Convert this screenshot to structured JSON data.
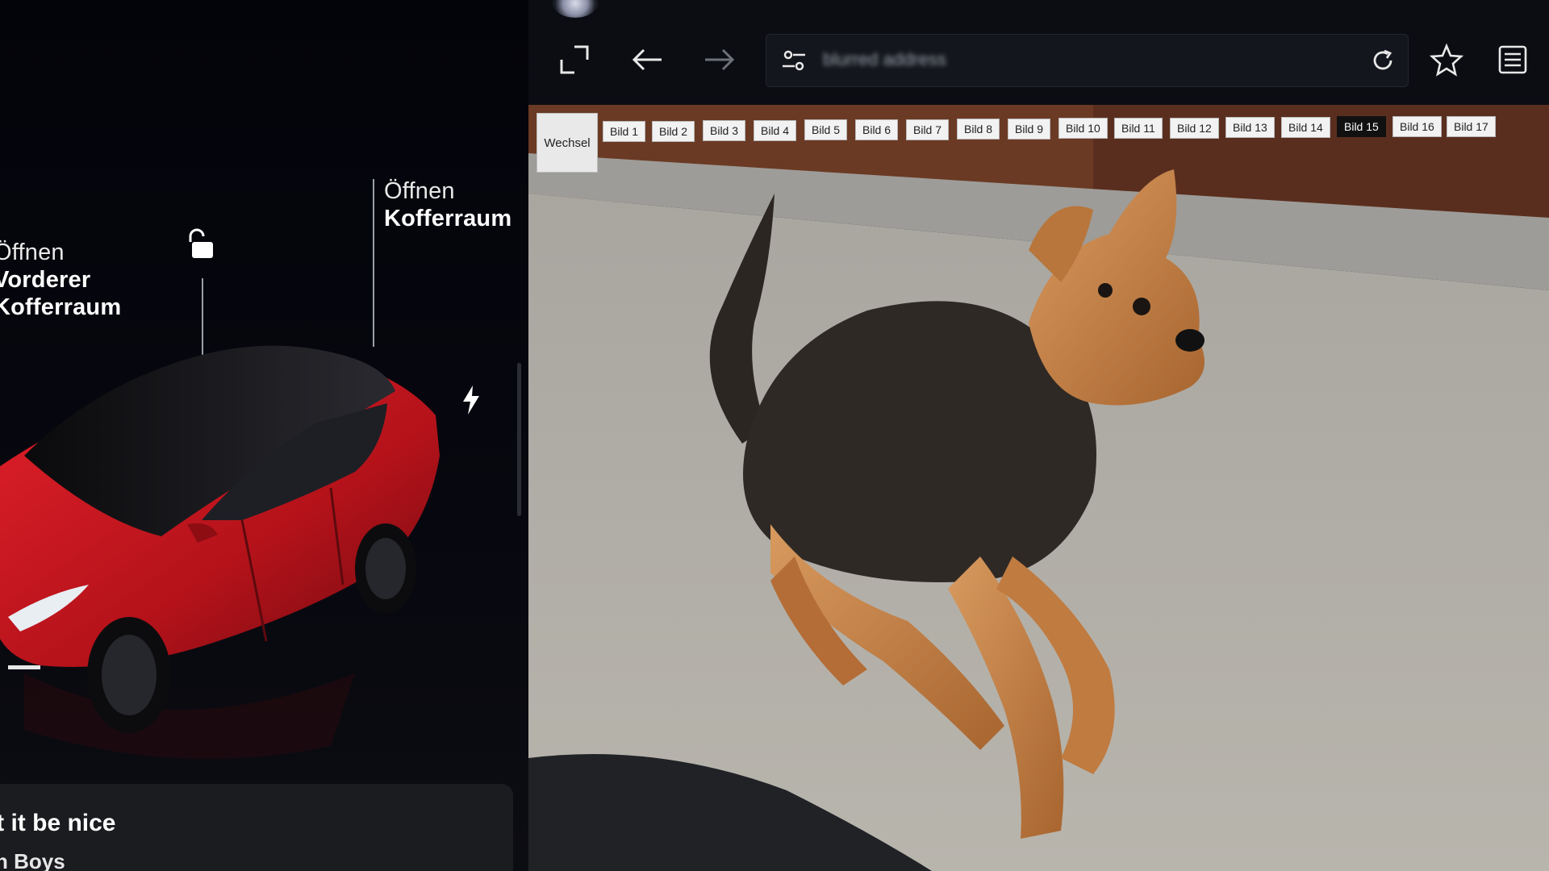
{
  "car_panel": {
    "front_trunk": {
      "action": "Öffnen",
      "line1": "Vorderer",
      "line2": "Kofferraum"
    },
    "rear_trunk": {
      "action": "Öffnen",
      "line1": "Kofferraum"
    },
    "lock_icon": "unlock-icon",
    "charge_icon": "lightning-icon",
    "car_color": "#c8141c"
  },
  "media": {
    "title": "'t it be nice",
    "artist": "n Boys"
  },
  "browser": {
    "url": "blurred address",
    "icons": {
      "fullscreen": "fullscreen-icon",
      "back": "arrow-left-icon",
      "forward": "arrow-right-icon",
      "site_settings": "sliders-icon",
      "reload": "reload-icon",
      "bookmark": "star-icon",
      "tabs": "tabs-list-icon"
    }
  },
  "webpage": {
    "switch_label": "Wechsel",
    "image_buttons": [
      "Bild 1",
      "Bild 2",
      "Bild 3",
      "Bild 4",
      "Bild 5",
      "Bild 6",
      "Bild 7",
      "Bild 8",
      "Bild 9",
      "Bild 10",
      "Bild 11",
      "Bild 12",
      "Bild 13",
      "Bild 14",
      "Bild 15",
      "Bild 16",
      "Bild 17"
    ],
    "active_image": "Bild 15"
  }
}
